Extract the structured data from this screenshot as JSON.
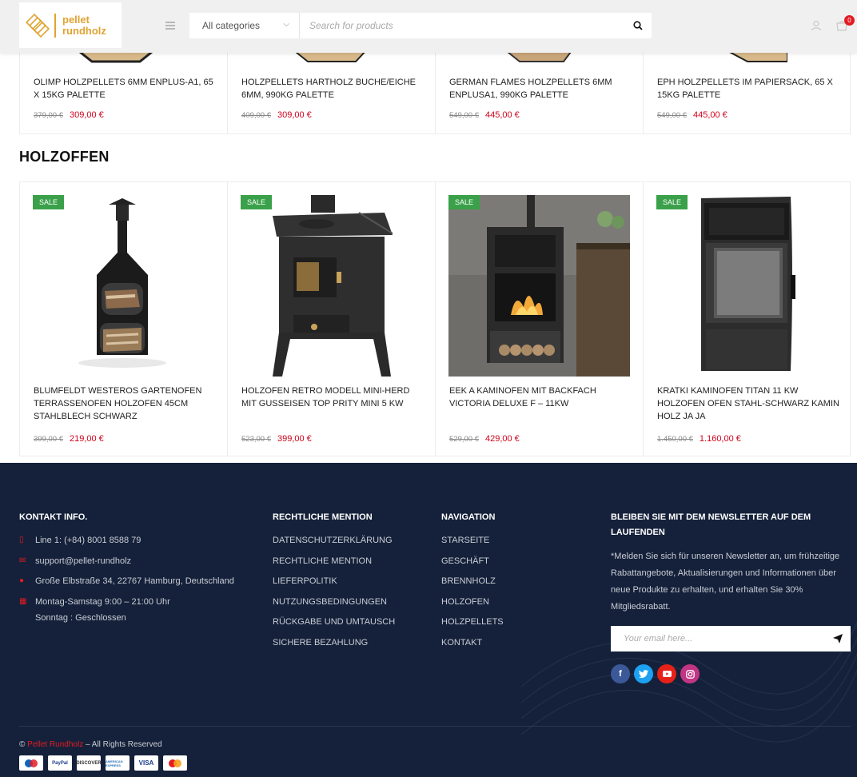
{
  "header": {
    "logo_line1": "pellet",
    "logo_line2": "rundholz",
    "category_select": "All categories",
    "search_placeholder": "Search for products",
    "cart_count": "0"
  },
  "top_products": [
    {
      "title": "OLIMP HOLZPELLETS 6MM ENPLUS-A1, 65 X 15KG PALETTE",
      "old_price": "379,00 €",
      "new_price": "309,00 €"
    },
    {
      "title": "HOLZPELLETS HARTHOLZ BUCHE/EICHE 6MM, 990KG PALETTE",
      "old_price": "409,00 €",
      "new_price": "309,00 €"
    },
    {
      "title": "GERMAN FLAMES HOLZPELLETS 6MM ENPLUSA1, 990KG PALETTE",
      "old_price": "549,00 €",
      "new_price": "445,00 €"
    },
    {
      "title": "EPH HOLZPELLETS IM PAPIERSACK, 65 X 15KG PALETTE",
      "old_price": "549,00 €",
      "new_price": "445,00 €"
    }
  ],
  "section_title": "HOLZOFFEN",
  "stoves": [
    {
      "badge": "SALE",
      "title": "BLUMFELDT WESTEROS GARTENOFEN TERRASSENOFEN HOLZOFEN 45CM STAHLBLECH SCHWARZ",
      "old_price": "399,00 €",
      "new_price": "219,00 €"
    },
    {
      "badge": "SALE",
      "title": "HOLZOFEN RETRO MODELL MINI-HERD MIT GUSSEISEN TOP PRITY MINI 5 KW",
      "old_price": "523,00 €",
      "new_price": "399,00 €"
    },
    {
      "badge": "SALE",
      "title": "EEK A KAMINOFEN MIT BACKFACH VICTORIA DELUXE F – 11KW",
      "old_price": "529,00 €",
      "new_price": "429,00 €"
    },
    {
      "badge": "SALE",
      "title": "KRATKI KAMINOFEN TITAN 11 KW HOLZOFEN OFEN STAHL-SCHWARZ KAMIN HOLZ JA JA",
      "old_price": "1.450,00 €",
      "new_price": "1.160,00 €"
    }
  ],
  "footer": {
    "contact": {
      "heading": "KONTAKT INFO.",
      "phone": "Line 1: (+84) 8001 8588 79",
      "email": "support@pellet-rundholz",
      "address": "Große Elbstraße 34, 22767 Hamburg, Deutschland",
      "hours1": "Montag-Samstag 9:00 – 21:00 Uhr",
      "hours2": "Sonntag : Geschlossen"
    },
    "legal": {
      "heading": "RECHTLICHE MENTION",
      "links": [
        "DATENSCHUTZERKLÄRUNG",
        "RECHTLICHE MENTION",
        "LIEFERPOLITIK",
        "NUTZUNGSBEDINGUNGEN",
        "RÜCKGABE UND UMTAUSCH",
        "SICHERE BEZAHLUNG"
      ]
    },
    "navigation": {
      "heading": "NAVIGATION",
      "links": [
        "STARSEITE",
        "GESCHÄFT",
        "BRENNHOLZ",
        "HOLZOFEN",
        "HOLZPELLETS",
        "KONTAKT"
      ]
    },
    "newsletter": {
      "heading": "BLEIBEN SIE MIT DEM NEWSLETTER AUF DEM LAUFENDEN",
      "text": "*Melden Sie sich für unseren Newsletter an, um frühzeitige Rabattangebote, Aktualisierungen und Informationen über neue Produkte zu erhalten, und erhalten Sie 30% Mitgliedsrabatt.",
      "email_placeholder": "Your email here..."
    },
    "copyright_prefix": "©",
    "copyright_brand": "Pellet Rundholz",
    "copyright_suffix": "– All Rights Reserved",
    "payments": [
      "Maestro",
      "PayPal",
      "DISCOVER",
      "AMERICAN EXPRESS",
      "VISA",
      "MasterCard"
    ]
  },
  "colors": {
    "accent_red": "#d0021b",
    "sale_green": "#3aa14a",
    "footer_bg": "#15213a",
    "logo_gold": "#e0a331"
  }
}
